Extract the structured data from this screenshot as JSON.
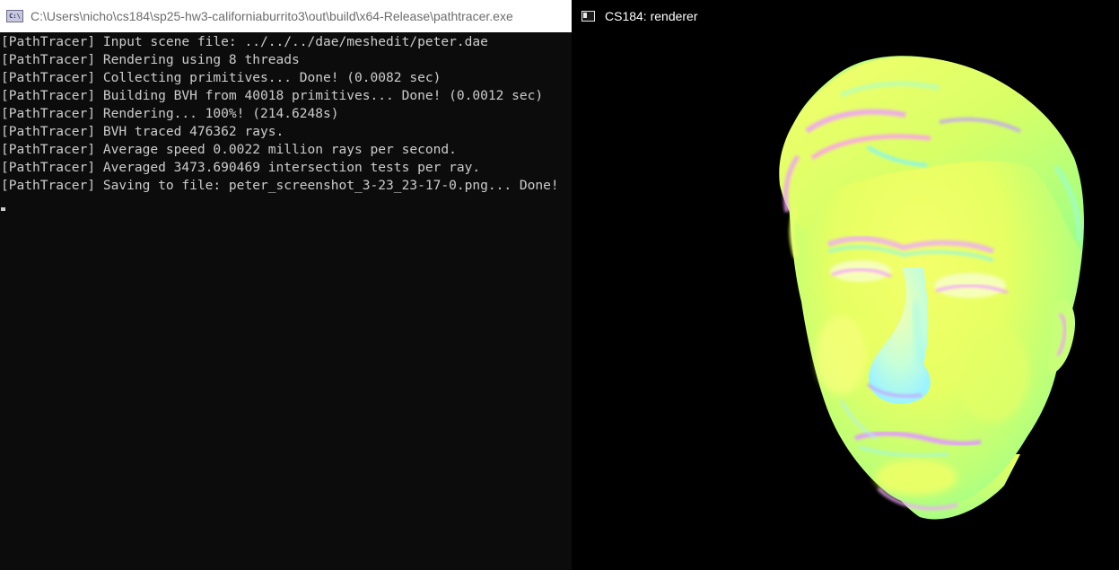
{
  "console_window": {
    "title": "C:\\Users\\nicho\\cs184\\sp25-hw3-californiaburrito3\\out\\build\\x64-Release\\pathtracer.exe",
    "icon": "console-app-icon",
    "icon_text": "C:\\",
    "lines": [
      "[PathTracer] Input scene file: ../../../dae/meshedit/peter.dae",
      "[PathTracer] Rendering using 8 threads",
      "[PathTracer] Collecting primitives... Done! (0.0082 sec)",
      "[PathTracer] Building BVH from 40018 primitives... Done! (0.0012 sec)",
      "[PathTracer] Rendering... 100%! (214.6248s)",
      "[PathTracer] BVH traced 476362 rays.",
      "[PathTracer] Average speed 0.0022 million rays per second.",
      "[PathTracer] Averaged 3473.690469 intersection tests per ray.",
      "[PathTracer] Saving to file: peter_screenshot_3-23_23-17-0.png... Done!"
    ]
  },
  "renderer_window": {
    "title": "CS184: renderer",
    "icon": "window-app-icon",
    "image": "normal-shaded-head-mesh"
  },
  "colors": {
    "console_bg": "#0c0c0c",
    "console_text": "#cccccc",
    "titlebar_bg": "#ffffff",
    "renderer_bg": "#000000",
    "mesh_yellow": "#eaff5a",
    "mesh_green": "#8dff9a",
    "mesh_magenta": "#f08cff",
    "mesh_cyan": "#7ef5ff"
  }
}
